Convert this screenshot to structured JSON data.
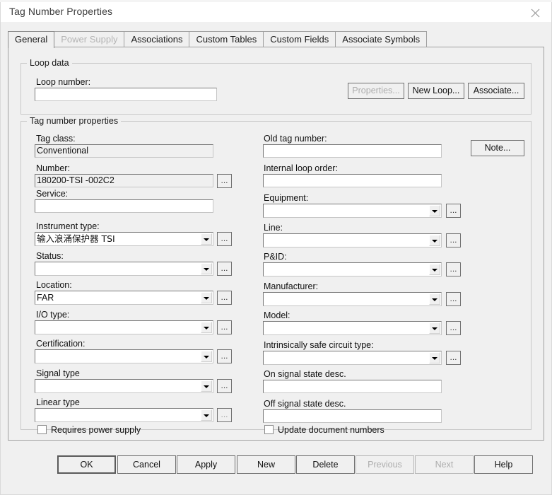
{
  "window": {
    "title": "Tag Number Properties",
    "close_icon": "close-icon"
  },
  "tabs": [
    {
      "label": "General",
      "selected": true,
      "disabled": false
    },
    {
      "label": "Power Supply",
      "selected": false,
      "disabled": true
    },
    {
      "label": "Associations",
      "selected": false,
      "disabled": false
    },
    {
      "label": "Custom Tables",
      "selected": false,
      "disabled": false
    },
    {
      "label": "Custom Fields",
      "selected": false,
      "disabled": false
    },
    {
      "label": "Associate Symbols",
      "selected": false,
      "disabled": false
    }
  ],
  "loop_data": {
    "group_title": "Loop data",
    "loop_number_label": "Loop number:",
    "loop_number_value": "",
    "buttons": {
      "properties": "Properties...",
      "new_loop": "New Loop...",
      "associate": "Associate..."
    }
  },
  "tag_properties": {
    "group_title": "Tag number properties",
    "note_button": "Note...",
    "left": [
      {
        "label": "Tag class:",
        "value": "Conventional",
        "kind": "text",
        "readonly": true,
        "browse": false
      },
      {
        "label": "Number:",
        "value": "180200-TSI  -002C2",
        "kind": "text",
        "readonly": true,
        "browse": true
      },
      {
        "label": "Service:",
        "value": "",
        "kind": "text",
        "readonly": false,
        "browse": false
      },
      {
        "label": "Instrument type:",
        "value": "输入浪涌保护器    TSI",
        "kind": "combo",
        "readonly": false,
        "browse": true
      },
      {
        "label": "Status:",
        "value": "",
        "kind": "combo",
        "readonly": false,
        "browse": true
      },
      {
        "label": "Location:",
        "value": "FAR",
        "kind": "combo",
        "readonly": false,
        "browse": true
      },
      {
        "label": "I/O type:",
        "value": "",
        "kind": "combo",
        "readonly": false,
        "browse": true
      },
      {
        "label": "Certification:",
        "value": "",
        "kind": "combo",
        "readonly": false,
        "browse": true
      },
      {
        "label": "Signal type",
        "value": "",
        "kind": "combo",
        "readonly": false,
        "browse": true
      },
      {
        "label": "Linear type",
        "value": "",
        "kind": "combo",
        "readonly": false,
        "browse": true
      }
    ],
    "right": [
      {
        "label": "Old tag number:",
        "value": "",
        "kind": "text",
        "readonly": false,
        "browse": false
      },
      {
        "label": "Internal loop order:",
        "value": "",
        "kind": "text",
        "readonly": false,
        "browse": false
      },
      {
        "label": "Equipment:",
        "value": "",
        "kind": "combo",
        "readonly": false,
        "browse": true
      },
      {
        "label": "Line:",
        "value": "",
        "kind": "combo",
        "readonly": false,
        "browse": true
      },
      {
        "label": "P&ID:",
        "value": "",
        "kind": "combo",
        "readonly": false,
        "browse": true
      },
      {
        "label": "Manufacturer:",
        "value": "",
        "kind": "combo",
        "readonly": false,
        "browse": true
      },
      {
        "label": "Model:",
        "value": "",
        "kind": "combo",
        "readonly": false,
        "browse": true
      },
      {
        "label": "Intrinsically safe circuit type:",
        "value": "",
        "kind": "combo",
        "readonly": false,
        "browse": true
      },
      {
        "label": "On signal state desc.",
        "value": "",
        "kind": "text",
        "readonly": false,
        "browse": false
      },
      {
        "label": "Off signal state desc.",
        "value": "",
        "kind": "text",
        "readonly": false,
        "browse": false
      }
    ],
    "checkboxes": [
      {
        "label": "Requires power supply",
        "checked": false
      },
      {
        "label": "Update document numbers",
        "checked": false
      }
    ]
  },
  "footer_buttons": [
    {
      "label": "OK",
      "default": true,
      "disabled": false
    },
    {
      "label": "Cancel",
      "default": false,
      "disabled": false
    },
    {
      "label": "Apply",
      "default": false,
      "disabled": false
    },
    {
      "label": "New",
      "default": false,
      "disabled": false
    },
    {
      "label": "Delete",
      "default": false,
      "disabled": false
    },
    {
      "label": "Previous",
      "default": false,
      "disabled": true
    },
    {
      "label": "Next",
      "default": false,
      "disabled": true
    },
    {
      "label": "Help",
      "default": false,
      "disabled": false
    }
  ],
  "colors": {
    "dialog_bg": "#f0f0f0",
    "field_bg": "#ffffff",
    "readonly_bg": "#f0f0f0",
    "border": "#7a7a7a",
    "disabled_text": "#b4b4b4"
  }
}
